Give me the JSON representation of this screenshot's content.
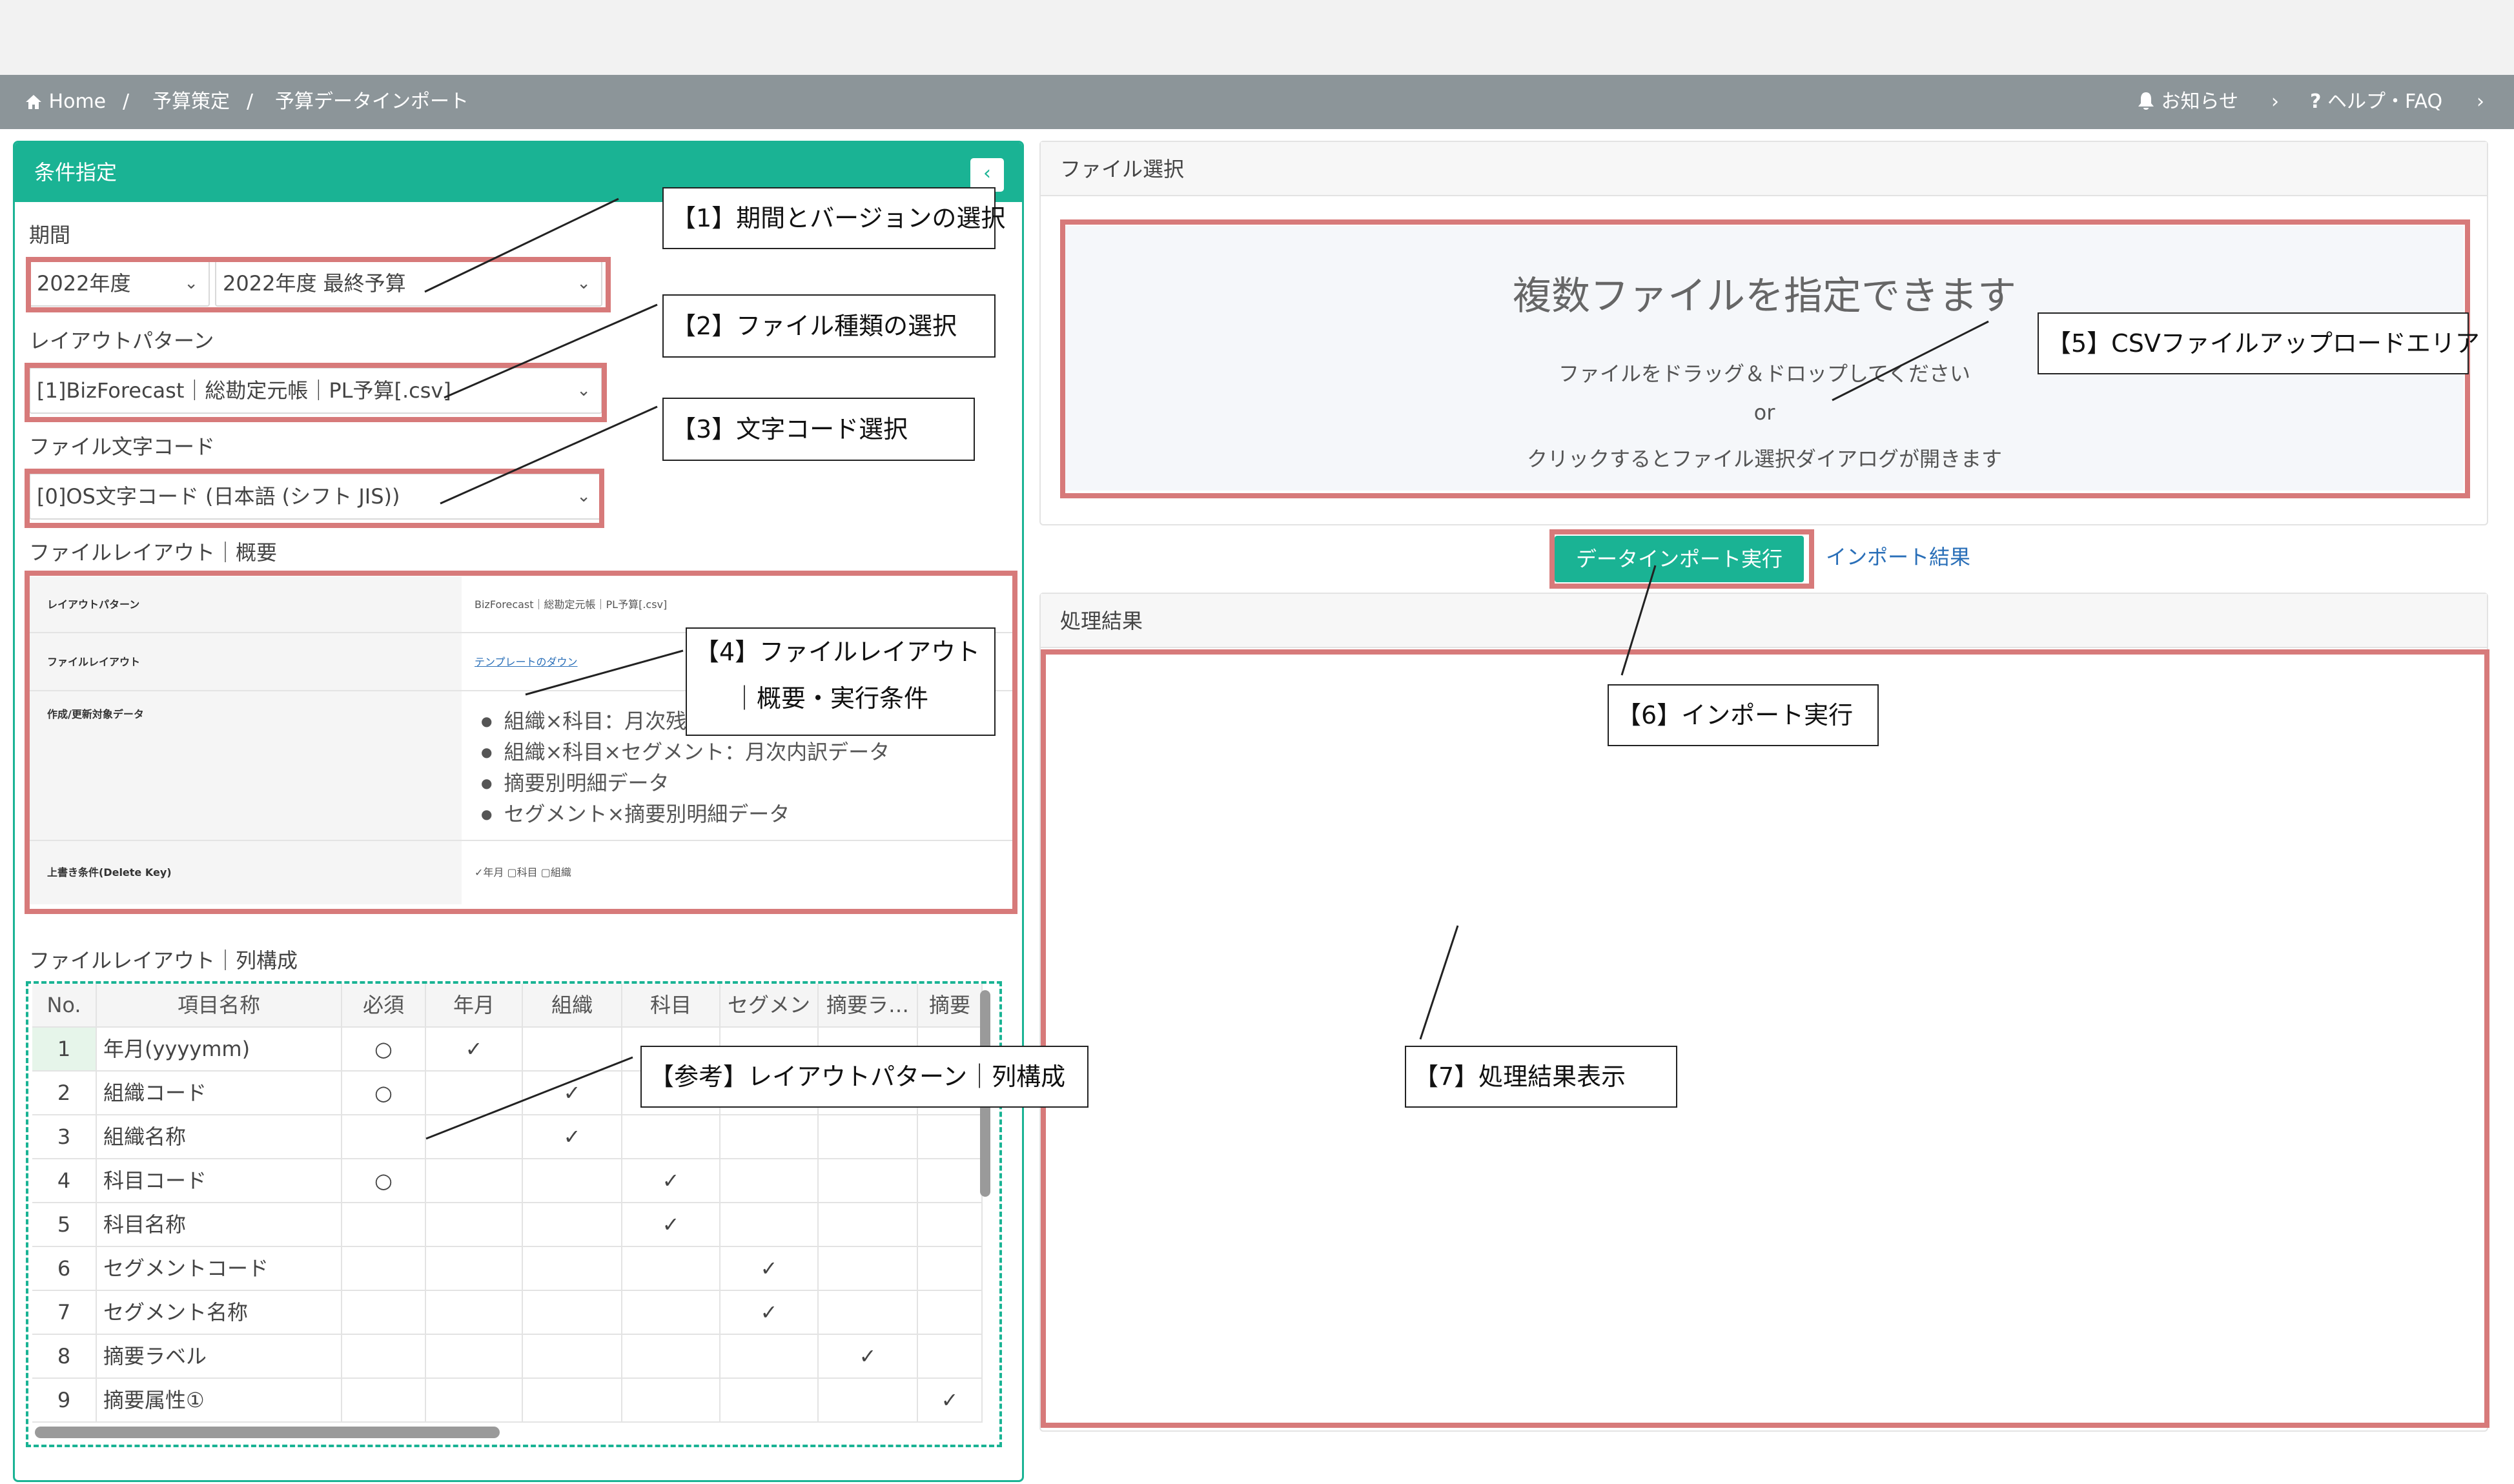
{
  "breadcrumb": {
    "home": "Home",
    "sep": "/",
    "level1": "予算策定",
    "level2": "予算データインポート"
  },
  "header_right": {
    "notice": "お知らせ",
    "help": "ヘルプ・FAQ",
    "help_mark": "?",
    "chevron": "›"
  },
  "left_panel": {
    "title": "条件指定",
    "collapse_glyph": "‹",
    "period_label": "期間",
    "year_value": "2022年度",
    "version_value": "2022年度 最終予算",
    "layout_pattern_label": "レイアウトパターン",
    "layout_pattern_value": "[1]BizForecast｜総勘定元帳｜PL予算[.csv]",
    "encoding_label": "ファイル文字コード",
    "encoding_value": "[0]OS文字コード (日本語 (シフト JIS))",
    "summary_label": "ファイルレイアウト｜概要",
    "summary": {
      "pattern_key": "レイアウトパターン",
      "pattern_val": "BizForecast｜総勘定元帳｜PL予算[.csv]",
      "file_layout_key": "ファイルレイアウト",
      "file_layout_val": "テンプレートのダウン",
      "target_key": "作成/更新対象データ",
      "targets": [
        "組織×科目：月次残",
        "組織×科目×セグメント：月次内訳データ",
        "摘要別明細データ",
        "セグメント×摘要別明細データ"
      ],
      "overwrite_key": "上書き条件(Delete Key)",
      "overwrite_val": "✓年月 ▢科目 ▢組織"
    },
    "columns_label": "ファイルレイアウト｜列構成",
    "grid": {
      "headers": [
        "No.",
        "項目名称",
        "必須",
        "年月",
        "組織",
        "科目",
        "セグメン",
        "摘要ラ…",
        "摘要"
      ],
      "rows": [
        {
          "no": "1",
          "name": "年月(yyyymm)",
          "req": "○",
          "ym": "✓",
          "org": "",
          "acct": "",
          "seg": "",
          "lbl": "",
          "attr": ""
        },
        {
          "no": "2",
          "name": "組織コード",
          "req": "○",
          "ym": "",
          "org": "✓",
          "acct": "",
          "seg": "",
          "lbl": "",
          "attr": ""
        },
        {
          "no": "3",
          "name": "組織名称",
          "req": "",
          "ym": "",
          "org": "✓",
          "acct": "",
          "seg": "",
          "lbl": "",
          "attr": ""
        },
        {
          "no": "4",
          "name": "科目コード",
          "req": "○",
          "ym": "",
          "org": "",
          "acct": "✓",
          "seg": "",
          "lbl": "",
          "attr": ""
        },
        {
          "no": "5",
          "name": "科目名称",
          "req": "",
          "ym": "",
          "org": "",
          "acct": "✓",
          "seg": "",
          "lbl": "",
          "attr": ""
        },
        {
          "no": "6",
          "name": "セグメントコード",
          "req": "",
          "ym": "",
          "org": "",
          "acct": "",
          "seg": "✓",
          "lbl": "",
          "attr": ""
        },
        {
          "no": "7",
          "name": "セグメント名称",
          "req": "",
          "ym": "",
          "org": "",
          "acct": "",
          "seg": "✓",
          "lbl": "",
          "attr": ""
        },
        {
          "no": "8",
          "name": "摘要ラベル",
          "req": "",
          "ym": "",
          "org": "",
          "acct": "",
          "seg": "",
          "lbl": "✓",
          "attr": ""
        },
        {
          "no": "9",
          "name": "摘要属性①",
          "req": "",
          "ym": "",
          "org": "",
          "acct": "",
          "seg": "",
          "lbl": "",
          "attr": "✓"
        }
      ]
    }
  },
  "file_select": {
    "title": "ファイル選択",
    "dz_title": "複数ファイルを指定できます",
    "dz_line1": "ファイルをドラッグ＆ドロップしてください",
    "dz_or": "or",
    "dz_line2": "クリックするとファイル選択ダイアログが開きます"
  },
  "actions": {
    "import_button": "データインポート実行",
    "import_result_link": "インポート結果"
  },
  "result": {
    "title": "処理結果"
  },
  "callouts": {
    "c1": "【1】期間とバージョンの選択",
    "c2": "【2】ファイル種類の選択",
    "c3": "【3】文字コード選択",
    "c4_line1": "【4】ファイルレイアウト",
    "c4_line2": "｜概要・実行条件",
    "c5": "【5】CSVファイルアップロードエリア",
    "c6": "【6】インポート実行",
    "c7": "【7】処理結果表示",
    "cref": "【参考】レイアウトパターン｜列構成"
  },
  "colors": {
    "accent": "#1ab394",
    "breadcrumb_bg": "#8c9599",
    "highlight_border": "#d77a7a",
    "link": "#2a6fb8"
  }
}
